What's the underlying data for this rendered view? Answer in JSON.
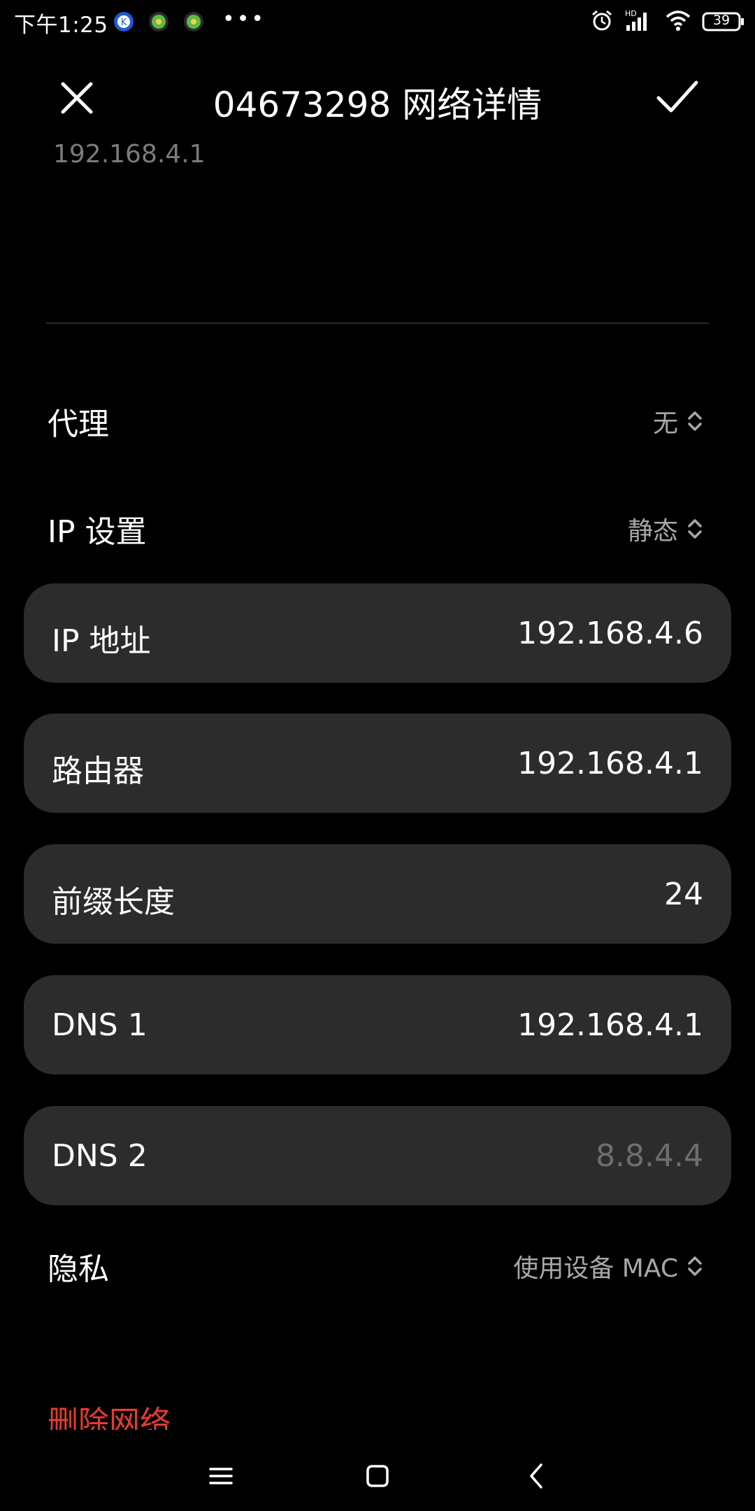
{
  "status_bar": {
    "time": "下午1:25",
    "more": "•••",
    "battery": "39",
    "network_type": "HD"
  },
  "header": {
    "title": "04673298 网络详情"
  },
  "top_faded_value": "192.168.4.1",
  "settings": {
    "proxy": {
      "label": "代理",
      "value": "无"
    },
    "ip_settings": {
      "label": "IP 设置",
      "value": "静态"
    },
    "privacy": {
      "label": "隐私",
      "value": "使用设备 MAC"
    }
  },
  "fields": {
    "ip_address": {
      "label": "IP 地址",
      "value": "192.168.4.6"
    },
    "router": {
      "label": "路由器",
      "value": "192.168.4.1"
    },
    "prefix_length": {
      "label": "前缀长度",
      "value": "24"
    },
    "dns1": {
      "label": "DNS 1",
      "value": "192.168.4.1"
    },
    "dns2": {
      "label": "DNS 2",
      "placeholder": "8.8.4.4"
    }
  },
  "delete_network": "删除网络",
  "colors": {
    "background": "#000000",
    "card": "#2c2c2c",
    "danger": "#e53b31",
    "secondary_text": "#a8a8a8"
  },
  "icons": [
    "close-icon",
    "check-icon",
    "updown-icon",
    "menu-icon",
    "home-icon",
    "back-icon",
    "alarm-icon",
    "signal-icon",
    "wifi-icon",
    "battery-icon"
  ]
}
